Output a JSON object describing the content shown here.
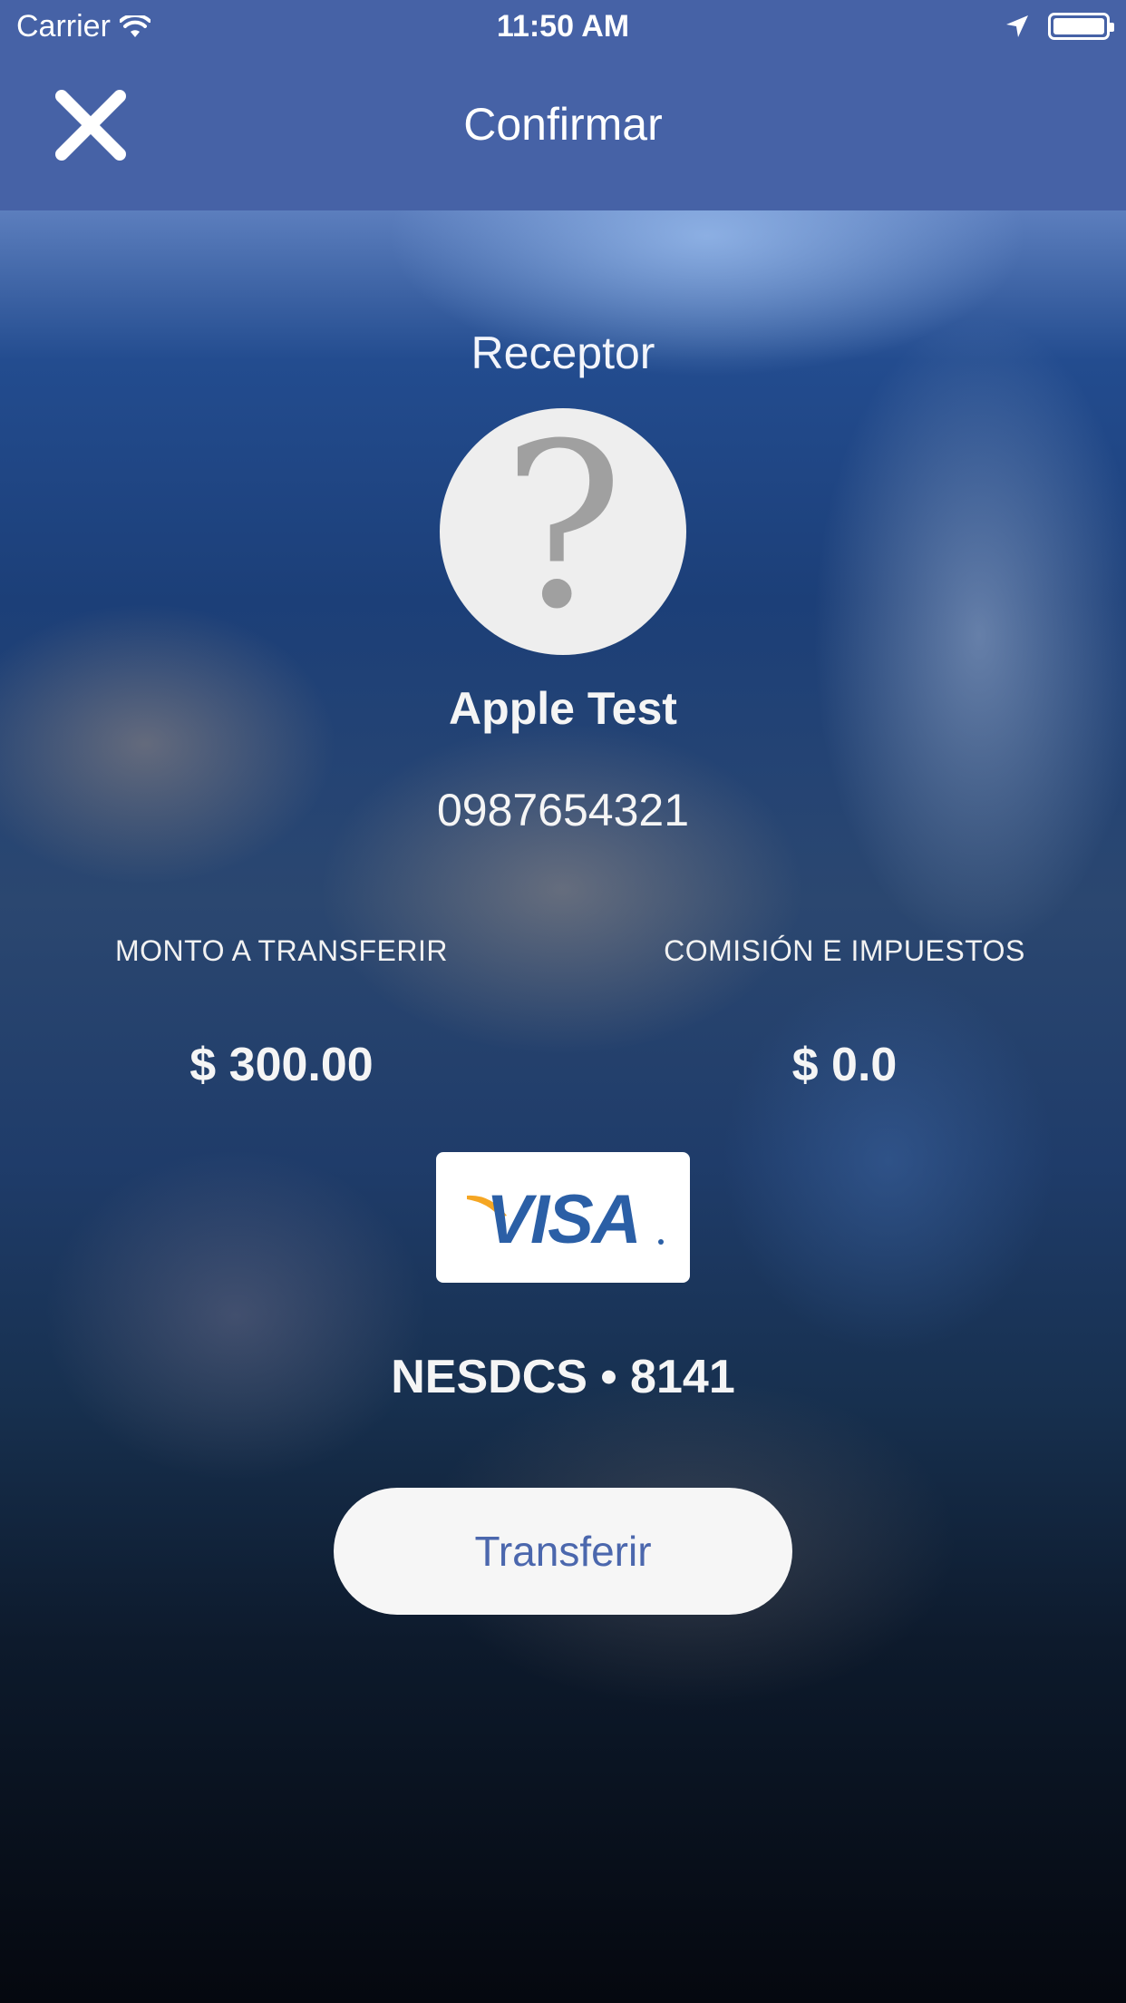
{
  "status_bar": {
    "carrier": "Carrier",
    "time": "11:50 AM"
  },
  "nav": {
    "title": "Confirmar",
    "close_icon": "close-icon"
  },
  "receiver": {
    "label": "Receptor",
    "avatar_icon": "question-mark-icon",
    "avatar_glyph": "?",
    "name": "Apple Test",
    "phone": "0987654321"
  },
  "amounts": {
    "transfer_label": "MONTO A TRANSFERIR",
    "transfer_value": "$ 300.00",
    "fee_label": "COMISIÓN E IMPUESTOS",
    "fee_value": "$ 0.0"
  },
  "card": {
    "brand": "VISA",
    "id_text": "NESDCS • 8141"
  },
  "actions": {
    "transfer_label": "Transferir"
  },
  "colors": {
    "nav_bg": "#4662a6",
    "button_text": "#4b67ad",
    "visa_blue": "#2b5fa6",
    "visa_orange": "#f5a623"
  }
}
